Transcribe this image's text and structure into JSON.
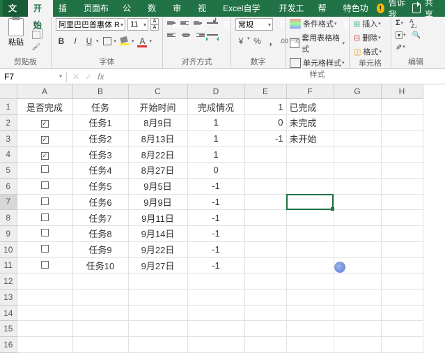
{
  "tabs": {
    "file": "文件",
    "items": [
      "开始",
      "插入",
      "页面布局",
      "公式",
      "数据",
      "审阅",
      "视图",
      "Excel自学成才",
      "开发工具",
      "帮助",
      "特色功能"
    ],
    "active": "开始",
    "tell_me": "告诉我",
    "share": "共享"
  },
  "ribbon": {
    "clipboard": {
      "paste": "粘贴",
      "label": "剪贴板"
    },
    "font": {
      "name": "阿里巴巴普惠体 R",
      "size": "11",
      "bold": "B",
      "italic": "I",
      "underline": "U",
      "color_letter": "A",
      "label": "字体"
    },
    "align": {
      "label": "对齐方式"
    },
    "number": {
      "format": "常规",
      "label": "数字"
    },
    "styles": {
      "cond": "条件格式",
      "table": "套用表格格式",
      "cell": "单元格样式",
      "label": "样式"
    },
    "cells": {
      "insert": "插入",
      "delete": "删除",
      "format": "格式",
      "label": "单元格"
    },
    "editing": {
      "label": "编辑"
    }
  },
  "formula_bar": {
    "name_box": "F7",
    "formula": ""
  },
  "sheet": {
    "columns": [
      "A",
      "B",
      "C",
      "D",
      "E",
      "F",
      "G",
      "H"
    ],
    "headers": {
      "A": "是否完成",
      "B": "任务",
      "C": "开始时间",
      "D": "完成情况"
    },
    "legend": [
      {
        "code": "1",
        "text": "已完成"
      },
      {
        "code": "0",
        "text": "未完成"
      },
      {
        "code": "-1",
        "text": "未开始"
      }
    ],
    "rows": [
      {
        "checked": true,
        "task": "任务1",
        "date": "8月9日",
        "status": "1"
      },
      {
        "checked": true,
        "task": "任务2",
        "date": "8月13日",
        "status": "1"
      },
      {
        "checked": true,
        "task": "任务3",
        "date": "8月22日",
        "status": "1"
      },
      {
        "checked": false,
        "task": "任务4",
        "date": "8月27日",
        "status": "0"
      },
      {
        "checked": false,
        "task": "任务5",
        "date": "9月5日",
        "status": "-1"
      },
      {
        "checked": false,
        "task": "任务6",
        "date": "9月9日",
        "status": "-1"
      },
      {
        "checked": false,
        "task": "任务7",
        "date": "9月11日",
        "status": "-1"
      },
      {
        "checked": false,
        "task": "任务8",
        "date": "9月14日",
        "status": "-1"
      },
      {
        "checked": false,
        "task": "任务9",
        "date": "9月22日",
        "status": "-1"
      },
      {
        "checked": false,
        "task": "任务10",
        "date": "9月27日",
        "status": "-1"
      }
    ],
    "active_cell": "F7",
    "row_count": 16
  }
}
